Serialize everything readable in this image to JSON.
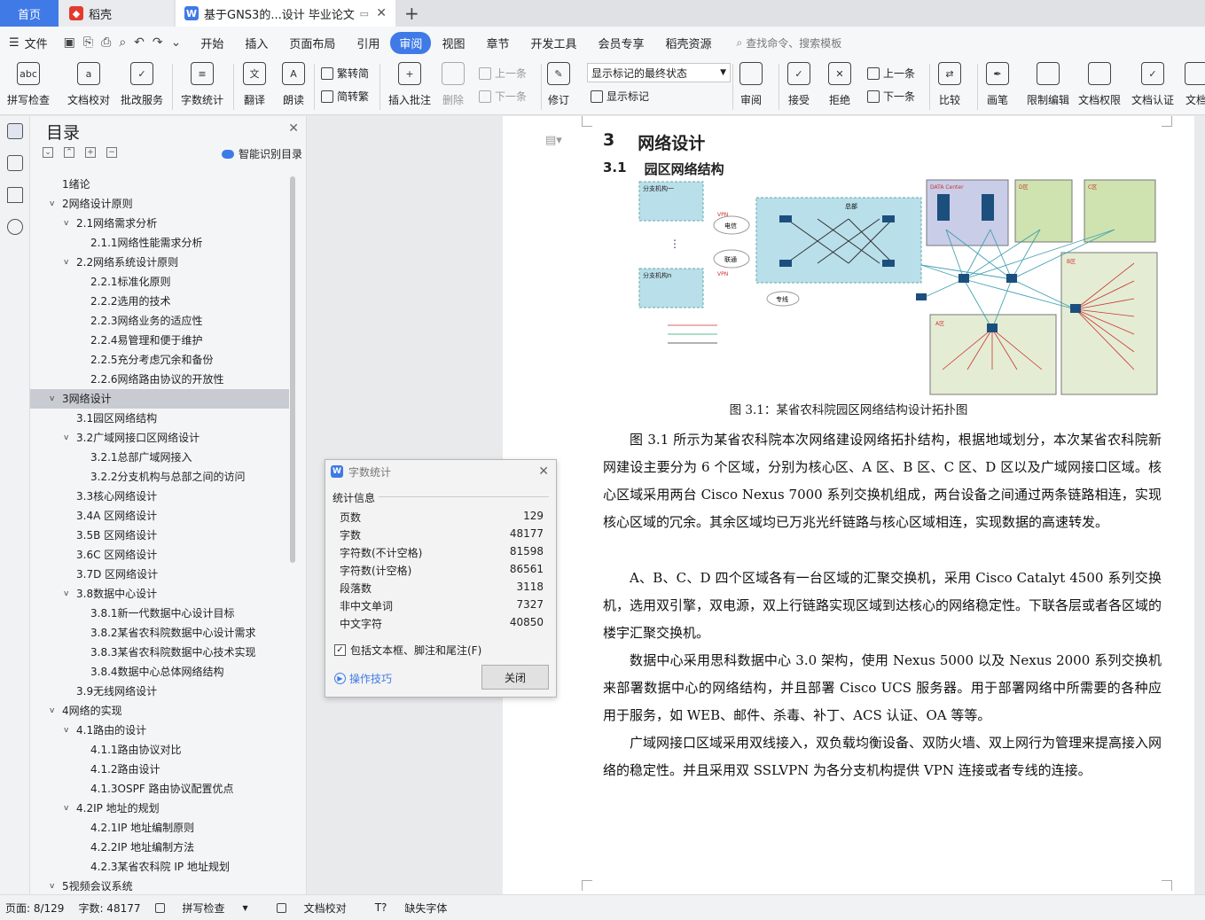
{
  "tabs": {
    "home": "首页",
    "daoke": "稻壳",
    "doc": "基于GNS3的...设计 毕业论文"
  },
  "menu": {
    "file": "文件",
    "items": [
      "开始",
      "插入",
      "页面布局",
      "引用",
      "审阅",
      "视图",
      "章节",
      "开发工具",
      "会员专享",
      "稻壳资源"
    ],
    "active": "审阅",
    "search": "查找命令、搜索模板"
  },
  "ribbon": {
    "spell": "拼写检查",
    "doccheck": "文档校对",
    "approve": "批改服务",
    "wordcount": "字数统计",
    "translate": "翻译",
    "read": "朗读",
    "t2s": "繁转简",
    "s2t": "简转繁",
    "comment": "插入批注",
    "delete": "删除",
    "prev": "上一条",
    "next": "下一条",
    "revise": "修订",
    "markup_state": "显示标记的最终状态",
    "show_marks": "显示标记",
    "review": "审阅",
    "accept": "接受",
    "reject": "拒绝",
    "prev2": "上一条",
    "next2": "下一条",
    "compare": "比较",
    "pen": "画笔",
    "restrict": "限制编辑",
    "permission": "文档权限",
    "certify": "文档认证",
    "more": "文档"
  },
  "toc": {
    "title": "目录",
    "smart": "智能识别目录",
    "items": [
      {
        "t": "1绪论",
        "l": 0,
        "a": ""
      },
      {
        "t": "2网络设计原则",
        "l": 0,
        "a": "v"
      },
      {
        "t": "2.1网络需求分析",
        "l": 1,
        "a": "v"
      },
      {
        "t": "2.1.1网络性能需求分析",
        "l": 2,
        "a": ""
      },
      {
        "t": "2.2网络系统设计原则",
        "l": 1,
        "a": "v"
      },
      {
        "t": "2.2.1标准化原则",
        "l": 2,
        "a": ""
      },
      {
        "t": "2.2.2选用的技术",
        "l": 2,
        "a": ""
      },
      {
        "t": "2.2.3网络业务的适应性",
        "l": 2,
        "a": ""
      },
      {
        "t": "2.2.4易管理和便于维护",
        "l": 2,
        "a": ""
      },
      {
        "t": "2.2.5充分考虑冗余和备份",
        "l": 2,
        "a": ""
      },
      {
        "t": "2.2.6网络路由协议的开放性",
        "l": 2,
        "a": ""
      },
      {
        "t": "3网络设计",
        "l": 0,
        "a": "v",
        "sel": true
      },
      {
        "t": "3.1园区网络结构",
        "l": 1,
        "a": ""
      },
      {
        "t": "3.2广域网接口区网络设计",
        "l": 1,
        "a": "v"
      },
      {
        "t": "3.2.1总部广域网接入",
        "l": 2,
        "a": ""
      },
      {
        "t": "3.2.2分支机构与总部之间的访问",
        "l": 2,
        "a": ""
      },
      {
        "t": "3.3核心网络设计",
        "l": 1,
        "a": ""
      },
      {
        "t": "3.4A 区网络设计",
        "l": 1,
        "a": ""
      },
      {
        "t": "3.5B 区网络设计",
        "l": 1,
        "a": ""
      },
      {
        "t": "3.6C 区网络设计",
        "l": 1,
        "a": ""
      },
      {
        "t": "3.7D 区网络设计",
        "l": 1,
        "a": ""
      },
      {
        "t": "3.8数据中心设计",
        "l": 1,
        "a": "v"
      },
      {
        "t": "3.8.1新一代数据中心设计目标",
        "l": 2,
        "a": ""
      },
      {
        "t": "3.8.2某省农科院数据中心设计需求",
        "l": 2,
        "a": ""
      },
      {
        "t": "3.8.3某省农科院数据中心技术实现",
        "l": 2,
        "a": ""
      },
      {
        "t": "3.8.4数据中心总体网络结构",
        "l": 2,
        "a": ""
      },
      {
        "t": "3.9无线网络设计",
        "l": 1,
        "a": ""
      },
      {
        "t": "4网络的实现",
        "l": 0,
        "a": "v"
      },
      {
        "t": "4.1路由的设计",
        "l": 1,
        "a": "v"
      },
      {
        "t": "4.1.1路由协议对比",
        "l": 2,
        "a": ""
      },
      {
        "t": "4.1.2路由设计",
        "l": 2,
        "a": ""
      },
      {
        "t": "4.1.3OSPF 路由协议配置优点",
        "l": 2,
        "a": ""
      },
      {
        "t": "4.2IP 地址的规划",
        "l": 1,
        "a": "v"
      },
      {
        "t": "4.2.1IP 地址编制原则",
        "l": 2,
        "a": ""
      },
      {
        "t": "4.2.2IP 地址编制方法",
        "l": 2,
        "a": ""
      },
      {
        "t": "4.2.3某省农科院 IP 地址规划",
        "l": 2,
        "a": ""
      },
      {
        "t": "5视频会议系统",
        "l": 0,
        "a": "v"
      }
    ]
  },
  "doc": {
    "h1_num": "3",
    "h1": "网络设计",
    "h2_num": "3.1",
    "h2": "园区网络结构",
    "caption": "图 3.1：某省农科院园区网络结构设计拓扑图",
    "diagram": {
      "branch1": "分支机构一",
      "branchn": "分支机构n",
      "hq": "总部",
      "dc": "DATA Center",
      "zoneD": "D区",
      "zoneC": "C区",
      "zoneB": "B区",
      "zoneA": "A区",
      "telecom": "电信",
      "unicom": "联通",
      "vpn": "VPN",
      "line": "专线"
    },
    "paras": [
      "图 3.1 所示为某省农科院本次网络建设网络拓扑结构，根据地域划分，本次某省农科院新网建设主要分为 6 个区域，分别为核心区、A 区、B 区、C 区、D 区以及广域网接口区域。核心区域采用两台 Cisco Nexus 7000 系列交换机组成，两台设备之间通过两条链路相连，实现核心区域的冗余。其余区域均已万兆光纤链路与核心区域相连，实现数据的高速转发。",
      "A、B、C、D 四个区域各有一台区域的汇聚交换机，采用 Cisco Catalyt 4500 系列交换机，选用双引擎，双电源，双上行链路实现区域到达核心的网络稳定性。下联各层或者各区域的楼宇汇聚交换机。",
      "数据中心采用思科数据中心 3.0 架构，使用 Nexus 5000 以及 Nexus 2000 系列交换机来部署数据中心的网络结构，并且部署 Cisco UCS 服务器。用于部署网络中所需要的各种应用于服务，如 WEB、邮件、杀毒、补丁、ACS 认证、OA 等等。",
      "广域网接口区域采用双线接入，双负载均衡设备、双防火墙、双上网行为管理来提高接入网络的稳定性。并且采用双 SSLVPN 为各分支机构提供 VPN 连接或者专线的连接。"
    ]
  },
  "dialog": {
    "title": "字数统计",
    "section": "统计信息",
    "rows": [
      {
        "k": "页数",
        "v": "129"
      },
      {
        "k": "字数",
        "v": "48177"
      },
      {
        "k": "字符数(不计空格)",
        "v": "81598"
      },
      {
        "k": "字符数(计空格)",
        "v": "86561"
      },
      {
        "k": "段落数",
        "v": "3118"
      },
      {
        "k": "非中文单词",
        "v": "7327"
      },
      {
        "k": "中文字符",
        "v": "40850"
      }
    ],
    "include": "包括文本框、脚注和尾注(F)",
    "tips": "操作技巧",
    "close": "关闭"
  },
  "status": {
    "page": "页面: 8/129",
    "words": "字数: 48177",
    "spell": "拼写检查",
    "check": "文档校对",
    "font": "缺失字体"
  },
  "colors": {
    "accent": "#3f7ae6",
    "wps_red": "#e23b2e"
  }
}
